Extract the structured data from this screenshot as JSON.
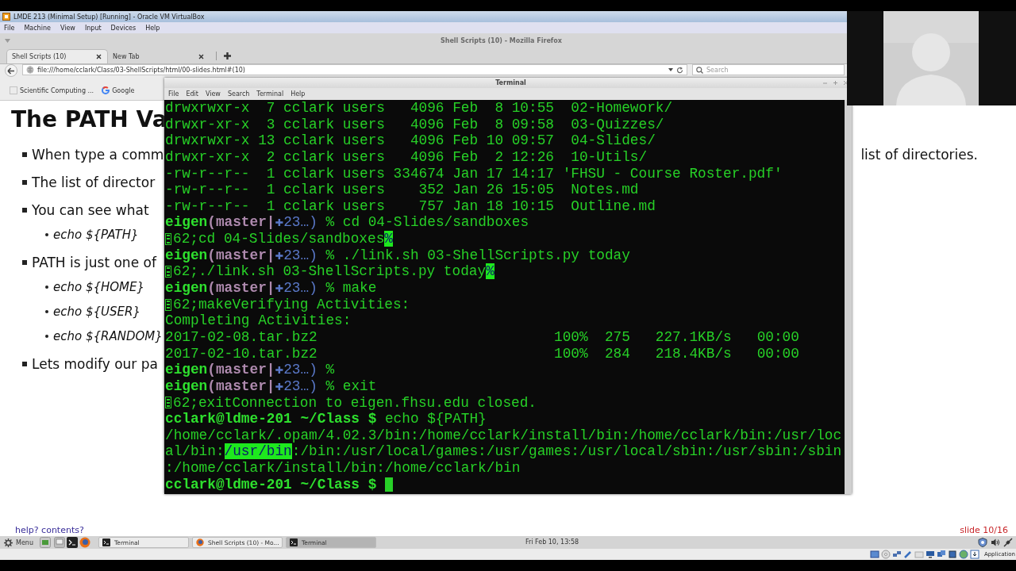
{
  "vbox": {
    "title": "LMDE 213 (Minimal Setup) [Running] - Oracle VM VirtualBox",
    "menu": [
      "File",
      "Machine",
      "View",
      "Input",
      "Devices",
      "Help"
    ],
    "host_key": "Application"
  },
  "browser": {
    "title": "Shell Scripts (10) - Mozilla Firefox",
    "tabs": [
      {
        "label": "Shell Scripts (10)",
        "selected": true
      },
      {
        "label": "New Tab",
        "selected": false
      }
    ],
    "url": "file:///home/cclark/Class/03-ShellScripts/html/00-slides.html#(10)",
    "search": {
      "placeholder": "Search"
    },
    "bookmarks": [
      {
        "label": "Scientific Computing ...",
        "kind": "folder"
      },
      {
        "label": "Google",
        "kind": "google"
      }
    ]
  },
  "slide": {
    "title": "The PATH Va",
    "bullets": [
      {
        "text": "When type a comm",
        "right_text": "list of directories."
      },
      {
        "text": "The list of director"
      },
      {
        "text": "You can see what",
        "children": [
          {
            "text": "echo ${PATH}"
          }
        ]
      },
      {
        "text": "PATH is just one of",
        "children": [
          {
            "text": "echo ${HOME}"
          },
          {
            "text": "echo ${USER}"
          },
          {
            "text": "echo ${RANDOM}"
          }
        ]
      },
      {
        "text": "Lets modify our pa"
      }
    ],
    "help": "help? contents?",
    "page": "slide 10/16"
  },
  "terminal": {
    "title": "Terminal",
    "menu": [
      "File",
      "Edit",
      "View",
      "Search",
      "Terminal",
      "Help"
    ],
    "lines": [
      {
        "kind": "plain",
        "text": "drwxrwxr-x  7 cclark users   4096 Feb  8 10:55  02-Homework/"
      },
      {
        "kind": "plain",
        "text": "drwxr-xr-x  3 cclark users   4096 Feb  8 09:58  03-Quizzes/"
      },
      {
        "kind": "plain",
        "text": "drwxrwxr-x 13 cclark users   4096 Feb 10 09:57  04-Slides/"
      },
      {
        "kind": "plain",
        "text": "drwxr-xr-x  2 cclark users   4096 Feb  2 12:26  10-Utils/"
      },
      {
        "kind": "plain",
        "text": "-rw-r--r--  1 cclark users 334674 Jan 17 14:17 'FHSU - Course Roster.pdf'"
      },
      {
        "kind": "plain",
        "text": "-rw-r--r--  1 cclark users    352 Jan 26 15:05  Notes.md"
      },
      {
        "kind": "plain",
        "text": "-rw-r--r--  1 cclark users    757 Jan 18 10:15  Outline.md"
      },
      {
        "kind": "prompt",
        "host": "eigen",
        "branch": "(master|",
        "status": "✚23…)",
        "command": "% cd 04-Slides/sandboxes"
      },
      {
        "kind": "osc",
        "text": "62;cd 04-Slides/sandboxes",
        "mark": "%"
      },
      {
        "kind": "prompt",
        "host": "eigen",
        "branch": "(master|",
        "status": "✚23…)",
        "command": "% ./link.sh 03-ShellScripts.py today"
      },
      {
        "kind": "osc",
        "text": "62;./link.sh 03-ShellScripts.py today",
        "mark": "%"
      },
      {
        "kind": "prompt",
        "host": "eigen",
        "branch": "(master|",
        "status": "✚23…)",
        "command": "% make"
      },
      {
        "kind": "osc",
        "text": "62;makeVerifying Activities:"
      },
      {
        "kind": "plain",
        "text": "Completing Activities:"
      },
      {
        "kind": "transfer",
        "file": "2017-02-08.tar.bz2",
        "stats": "100%  275   227.1KB/s   00:00"
      },
      {
        "kind": "transfer",
        "file": "2017-02-10.tar.bz2",
        "stats": "100%  284   218.4KB/s   00:00"
      },
      {
        "kind": "prompt",
        "host": "eigen",
        "branch": "(master|",
        "status": "✚23…)",
        "command": "%"
      },
      {
        "kind": "prompt",
        "host": "eigen",
        "branch": "(master|",
        "status": "✚23…)",
        "command": "% exit"
      },
      {
        "kind": "osc",
        "text": "62;exitConnection to eigen.fhsu.edu closed."
      },
      {
        "kind": "shell",
        "prompt": "cclark@ldme-201 ~/Class $",
        "command": "echo ${PATH}"
      },
      {
        "kind": "plain",
        "text": "/home/cclark/.opam/4.02.3/bin:/home/cclark/install/bin:/home/cclark/bin:/usr/loc"
      },
      {
        "kind": "highlighted",
        "before": "al/bin:",
        "highlight": "/usr/bin",
        "after": ":/bin:/usr/local/games:/usr/games:/usr/local/sbin:/usr/sbin:/sbin"
      },
      {
        "kind": "plain",
        "text": ":/home/cclark/install/bin:/home/cclark/bin"
      },
      {
        "kind": "shell",
        "prompt": "cclark@ldme-201 ~/Class $",
        "cursor": true
      }
    ]
  },
  "taskbar": {
    "menu": "Menu",
    "tasks": [
      {
        "label": "Terminal",
        "kind": "terminal",
        "selected": false
      },
      {
        "label": "Shell Scripts (10) - Mo...",
        "kind": "browser",
        "selected": false
      },
      {
        "label": "Terminal",
        "kind": "terminal",
        "selected": true
      }
    ],
    "clock": "Fri Feb 10, 13:58"
  }
}
